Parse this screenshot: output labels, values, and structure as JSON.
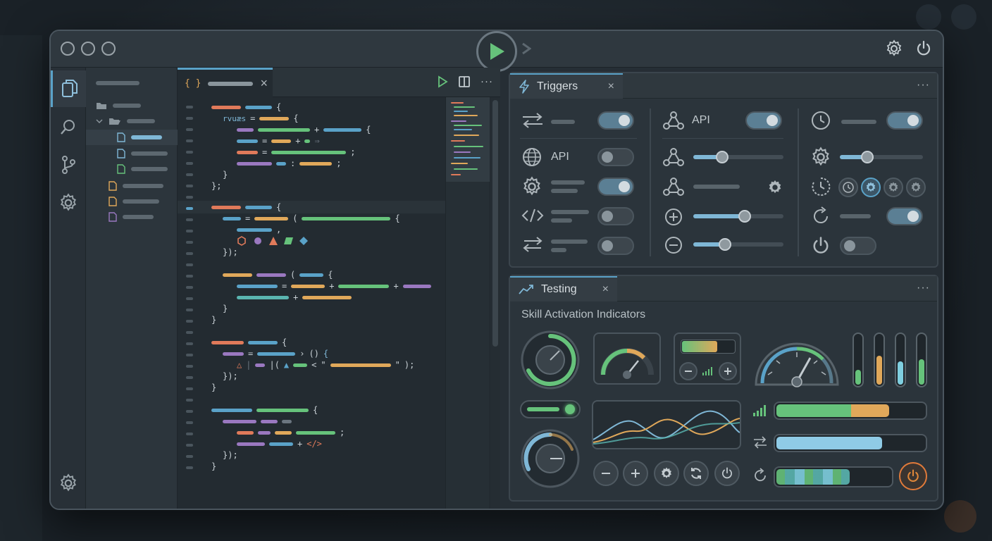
{
  "app": {
    "accent": "#5aa2c8",
    "green": "#66c27b",
    "orange": "#e0a85a"
  },
  "titlebar": {
    "run_icon": "play-icon",
    "settings_icon": "gear-icon",
    "power_icon": "power-icon"
  },
  "editor": {
    "tab_icon": "{ }",
    "tab_close": "×",
    "code_snippets": {
      "keyword": "rvuæs",
      "plus1": "+",
      "open_brace1": "{",
      "close1": "}",
      "close_semi1": "};",
      "string_open": "\"",
      "string_close": "\"",
      "tag": "</>"
    }
  },
  "triggers_panel": {
    "tab_label": "Triggers",
    "tab_close": "×",
    "more": "···",
    "col1": {
      "items": [
        {
          "icon": "arrows-icon",
          "label": "",
          "toggle": "on"
        },
        {
          "icon": "globe-icon",
          "label": "API",
          "toggle": "off"
        },
        {
          "icon": "gear-icon",
          "label": "",
          "toggle": "on"
        },
        {
          "icon": "code-icon",
          "label": "",
          "toggle": "off"
        },
        {
          "icon": "swap-icon",
          "label": "",
          "toggle": "off"
        }
      ]
    },
    "col2": {
      "items": [
        {
          "icon": "webhook-icon",
          "label": "API",
          "control": "toggle-on"
        },
        {
          "icon": "webhook-icon",
          "control": "slider",
          "value": 0.35
        },
        {
          "icon": "webhook-icon",
          "control": "gear"
        },
        {
          "icon": "plus-circle-icon",
          "control": "slider",
          "value": 0.6
        },
        {
          "icon": "minus-circle-icon",
          "control": "slider",
          "value": 0.35
        }
      ]
    },
    "col3": {
      "items": [
        {
          "icon": "clock-icon",
          "control": "toggle-on"
        },
        {
          "icon": "gear-icon",
          "control": "slider",
          "value": 0.3
        },
        {
          "icon": "timer-icon",
          "control": "mini-icons"
        },
        {
          "icon": "refresh-icon",
          "control": "toggle-on"
        },
        {
          "icon": "power-icon",
          "control": "toggle-off"
        }
      ]
    }
  },
  "testing_panel": {
    "tab_label": "Testing",
    "tab_close": "×",
    "more": "···",
    "heading": "Skill Activation Indicators",
    "vmeters": [
      0.3,
      0.55,
      0.45,
      0.5
    ],
    "hbars": [
      {
        "icon": "signal-icon",
        "green": 0.52,
        "orange": 0.2
      },
      {
        "icon": "swap-icon",
        "blue": 0.72
      },
      {
        "icon": "refresh-icon",
        "teal": 0.62
      }
    ]
  }
}
